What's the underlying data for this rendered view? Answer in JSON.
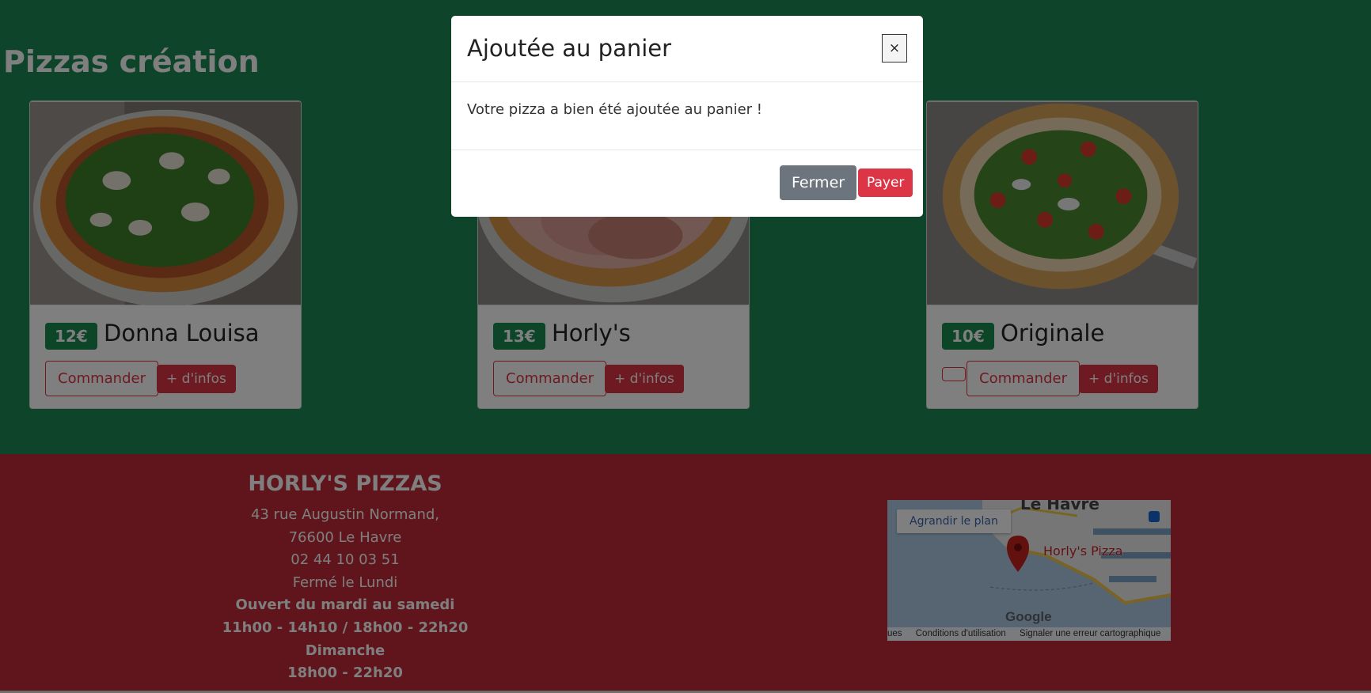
{
  "section": {
    "title": "Pizzas création"
  },
  "pizzas": [
    {
      "price": "12€",
      "name": "Donna Louisa",
      "order_label": "Commander",
      "info_label": "+ d'infos"
    },
    {
      "price": "13€",
      "name": "Horly's",
      "order_label": "Commander",
      "info_label": "+ d'infos"
    },
    {
      "price": "10€",
      "name": "Originale",
      "order_label": "Commander",
      "info_label": "+ d'infos"
    }
  ],
  "footer": {
    "title": "HORLY'S PIZZAS",
    "address_line1": "43 rue Augustin Normand,",
    "address_line2": "76600 Le Havre",
    "phone": "02 44 10 03 51",
    "closed": "Fermé le Lundi",
    "open_days": "Ouvert du mardi au samedi",
    "open_hours": "11h00 - 14h10 / 18h00 - 22h20",
    "sunday": "Dimanche",
    "sunday_hours": "18h00 - 22h20"
  },
  "map": {
    "enlarge_label": "Agrandir le plan",
    "city_label": "Le Havre",
    "place_label": "Horly's Pizza",
    "google_label": "Google",
    "footer_left": "ues",
    "terms_label": "Conditions d'utilisation",
    "report_label": "Signaler une erreur cartographique"
  },
  "modal": {
    "title": "Ajoutée au panier",
    "close_symbol": "×",
    "message": "Votre pizza a bien été ajoutée au panier !",
    "close_label": "Fermer",
    "pay_label": "Payer"
  }
}
